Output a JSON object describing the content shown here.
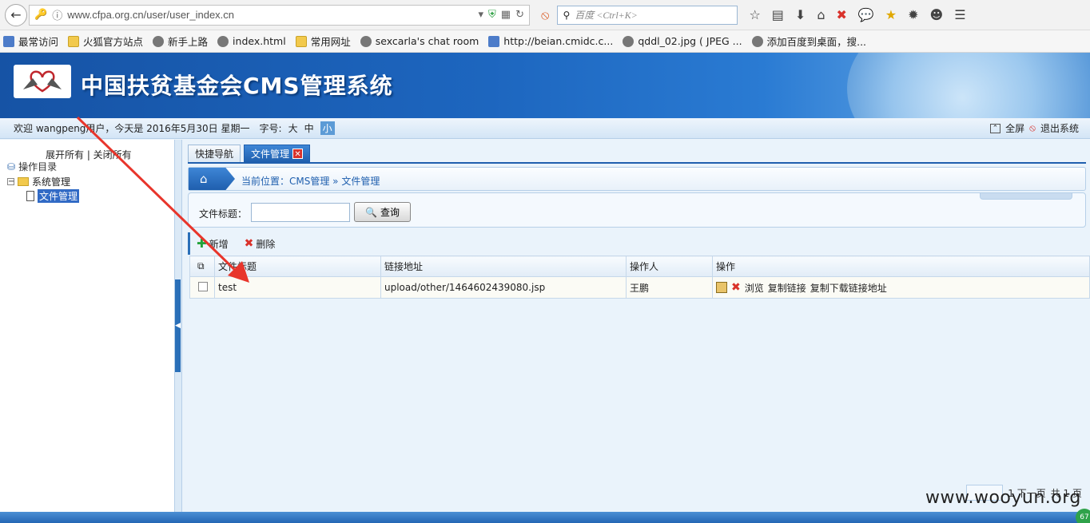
{
  "browser": {
    "url": "www.cfpa.org.cn/user/user_index.cn",
    "search_placeholder": "百度 <Ctrl+K>",
    "bookmarks": [
      "最常访问",
      "火狐官方站点",
      "新手上路",
      "index.html",
      "常用网址",
      "sexcarla's chat room",
      "http://beian.cmidc.c...",
      "qddl_02.jpg ( JPEG ...",
      "添加百度到桌面，搜..."
    ]
  },
  "banner": {
    "title": "中国扶贫基金会CMS管理系统"
  },
  "welcome": {
    "text": "欢迎 wangpeng用户，今天是 2016年5月30日 星期一",
    "font_label": "字号:",
    "font_sizes": [
      "大",
      "中",
      "小"
    ],
    "fullscreen": "全屏",
    "logout": "退出系统"
  },
  "tree": {
    "toggle": "展开所有 | 关闭所有",
    "root": "操作目录",
    "group": "系统管理",
    "item": "文件管理"
  },
  "tabs": [
    {
      "label": "快捷导航"
    },
    {
      "label": "文件管理"
    }
  ],
  "breadcrumb": "当前位置：CMS管理 » 文件管理",
  "query": {
    "label": "文件标题：",
    "button": "查询"
  },
  "toolbar": {
    "add": "新增",
    "delete": "删除"
  },
  "table": {
    "headers": [
      "文件标题",
      "链接地址",
      "操作人",
      "操作"
    ],
    "rows": [
      {
        "title": "test",
        "link": "upload/other/1464602439080.jsp",
        "operator": "王鹏",
        "ops": [
          "浏览",
          "复制链接",
          "复制下载链接地址"
        ]
      }
    ]
  },
  "pager": {
    "next": "1 下一页",
    "total": "共 1 页"
  },
  "watermark": "www.wooyun.org",
  "corner_badge": "67",
  "colors": {
    "accent": "#1f5fae",
    "annotation_arrow": "#e8352b"
  }
}
